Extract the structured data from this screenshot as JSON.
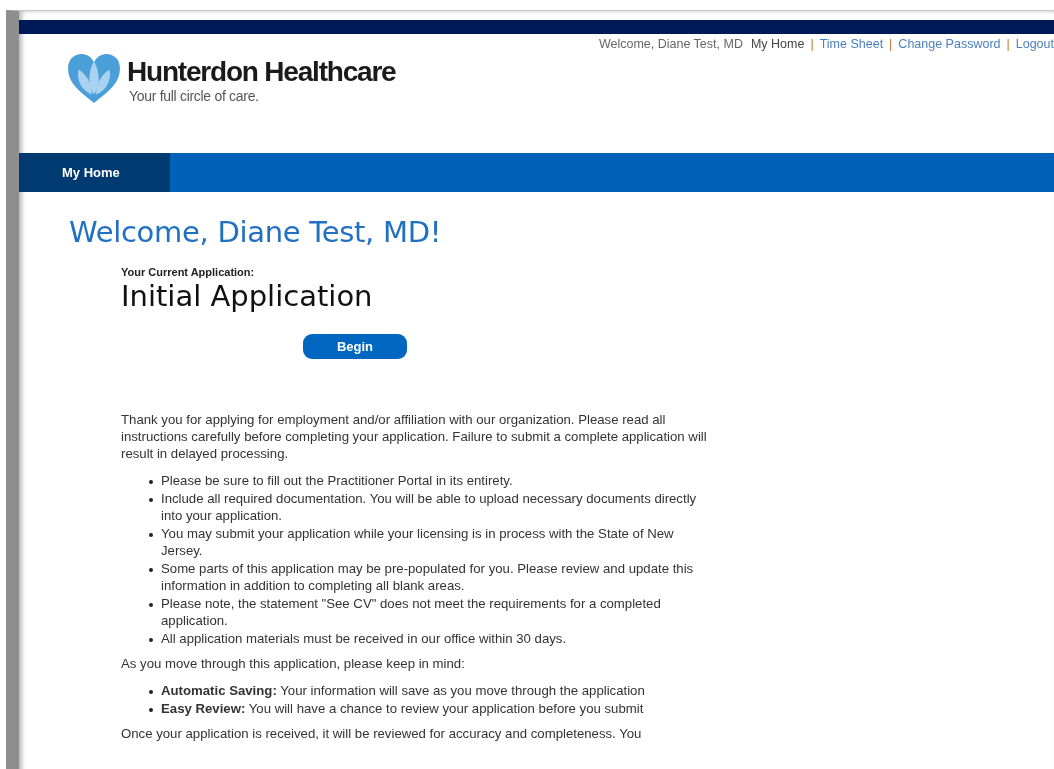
{
  "header": {
    "brand": "Hunterdon Healthcare",
    "tagline": "Your full circle of care.",
    "greeting": "Welcome, Diane Test, MD",
    "links": [
      {
        "label": "My Home",
        "kind": "current"
      },
      {
        "label": "|",
        "kind": "separator"
      },
      {
        "label": "Time Sheet",
        "kind": "link"
      },
      {
        "label": "|",
        "kind": "separator"
      },
      {
        "label": "Change Password",
        "kind": "link"
      },
      {
        "label": "|",
        "kind": "separator"
      },
      {
        "label": "Logout",
        "kind": "link"
      }
    ]
  },
  "nav": {
    "tabs": [
      {
        "label": "My Home",
        "selected": true
      }
    ]
  },
  "main": {
    "title": "Welcome, Diane Test, MD!",
    "application_label": "Your Current Application:",
    "application_name": "Initial Application",
    "begin_button": "Begin",
    "intro": "Thank you for applying for employment and/or affiliation with our organization. Please read all instructions carefully before completing your application. Failure to submit a complete application will result in delayed processing.",
    "instructions": [
      "Please be sure to fill out the Practitioner Portal in its entirety.",
      "Include all required documentation.  You will be able to upload necessary documents directly into your application.",
      "You may submit your application while your licensing is in process with the State of New Jersey.",
      "Some parts of this application may be pre-populated for you. Please review and update this information in addition to completing all blank areas.",
      "Please note, the statement \"See CV\" does not meet the requirements for a completed application.",
      "All application materials must be received in our office within 30 days."
    ],
    "keep_in_mind": "As you move through this application, please keep in mind:",
    "tips": [
      "**Automatic Saving:** Your information will save as you move through the application",
      "**Easy Review:** You will have a chance to review your application before you submit"
    ],
    "closing": "Once your application is received, it will be reviewed for accuracy and completeness.  You"
  }
}
